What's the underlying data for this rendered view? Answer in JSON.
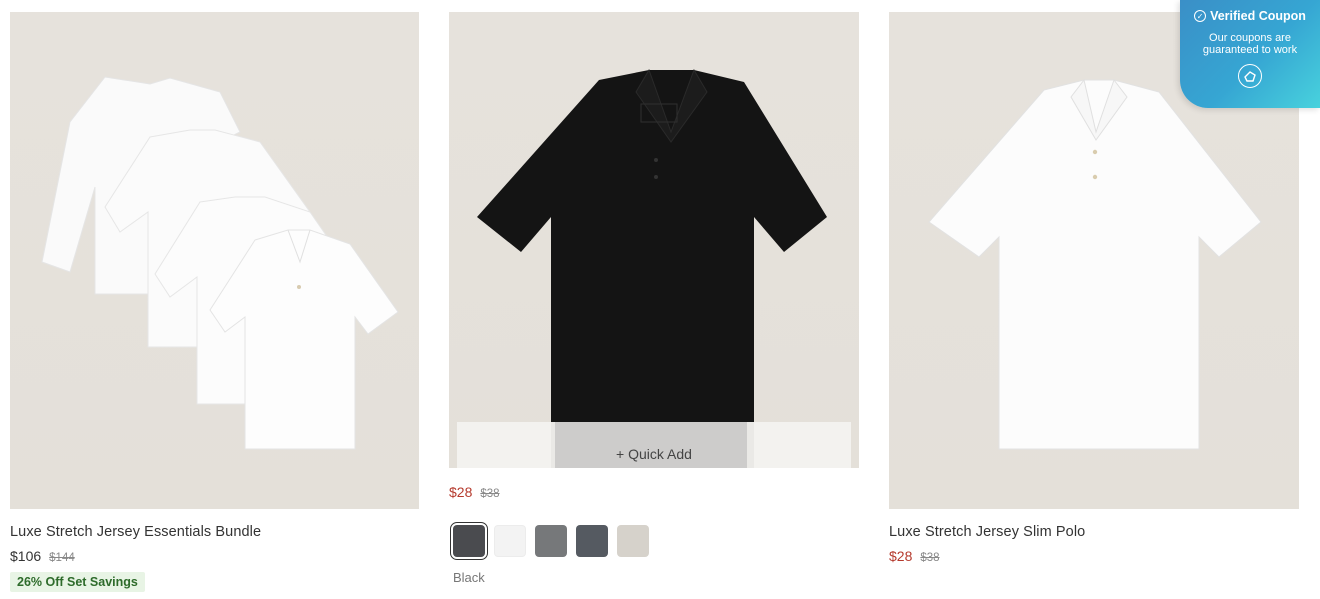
{
  "products": [
    {
      "title": "Luxe Stretch Jersey Essentials Bundle",
      "price": "$106",
      "was": "$144",
      "badge": "26% Off Set Savings"
    },
    {
      "title": "",
      "price": "$28",
      "was": "$38",
      "quick_add": "+ Quick Add",
      "swatches": [
        {
          "name": "Black",
          "color": "#4a4b4f",
          "selected": true
        },
        {
          "name": "White",
          "color": "#f3f3f3"
        },
        {
          "name": "Grey",
          "color": "#76787a"
        },
        {
          "name": "Slate",
          "color": "#555a61"
        },
        {
          "name": "Stone",
          "color": "#d6d2cb"
        }
      ],
      "selected_color": "Black"
    },
    {
      "title": "Luxe Stretch Jersey Slim Polo",
      "price": "$28",
      "was": "$38"
    }
  ],
  "coupon": {
    "title": "Verified Coupon",
    "line1": "Our coupons are",
    "line2": "guaranteed to work"
  },
  "colors": {
    "sale": "#b53a2d",
    "badge_bg": "#e8f4e5",
    "badge_text": "#2e6b2b",
    "coupon_start": "#3a8fc7",
    "coupon_end": "#48d2dd"
  }
}
